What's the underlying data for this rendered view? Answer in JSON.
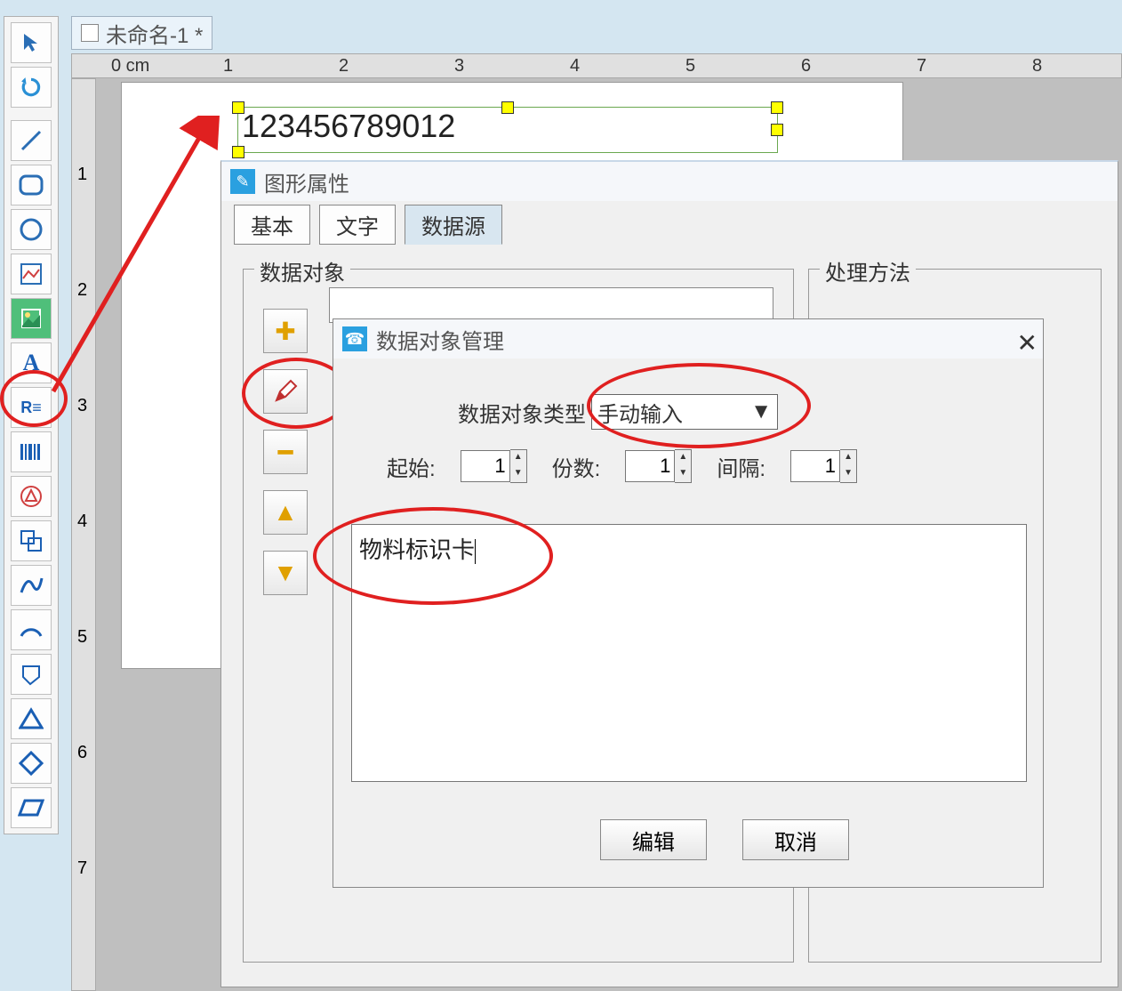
{
  "doc": {
    "title": "未命名-1 *"
  },
  "ruler": {
    "unit_label": "0 cm",
    "h_labels": [
      "1",
      "2",
      "3",
      "4",
      "5",
      "6",
      "7",
      "8"
    ],
    "v_labels": [
      "1",
      "2",
      "3",
      "4",
      "5",
      "6",
      "7"
    ]
  },
  "canvas": {
    "selected_text": "123456789012"
  },
  "tools": [
    "pointer",
    "rotate",
    "line",
    "rounded-rect",
    "ellipse",
    "image-frame",
    "image",
    "text",
    "rich-text",
    "barcode",
    "qr-shape",
    "group",
    "curve",
    "arc",
    "polygon-k",
    "triangle",
    "diamond",
    "parallelogram"
  ],
  "prop_dialog": {
    "title": "图形属性",
    "tabs": {
      "basic": "基本",
      "text": "文字",
      "datasource": "数据源"
    },
    "group_data": "数据对象",
    "group_method": "处理方法"
  },
  "manager_dialog": {
    "title": "数据对象管理",
    "type_label": "数据对象类型",
    "type_value": "手动输入",
    "start_label": "起始:",
    "start_value": "1",
    "copies_label": "份数:",
    "copies_value": "1",
    "interval_label": "间隔:",
    "interval_value": "1",
    "text_value": "物料标识卡",
    "edit_btn": "编辑",
    "cancel_btn": "取消"
  }
}
